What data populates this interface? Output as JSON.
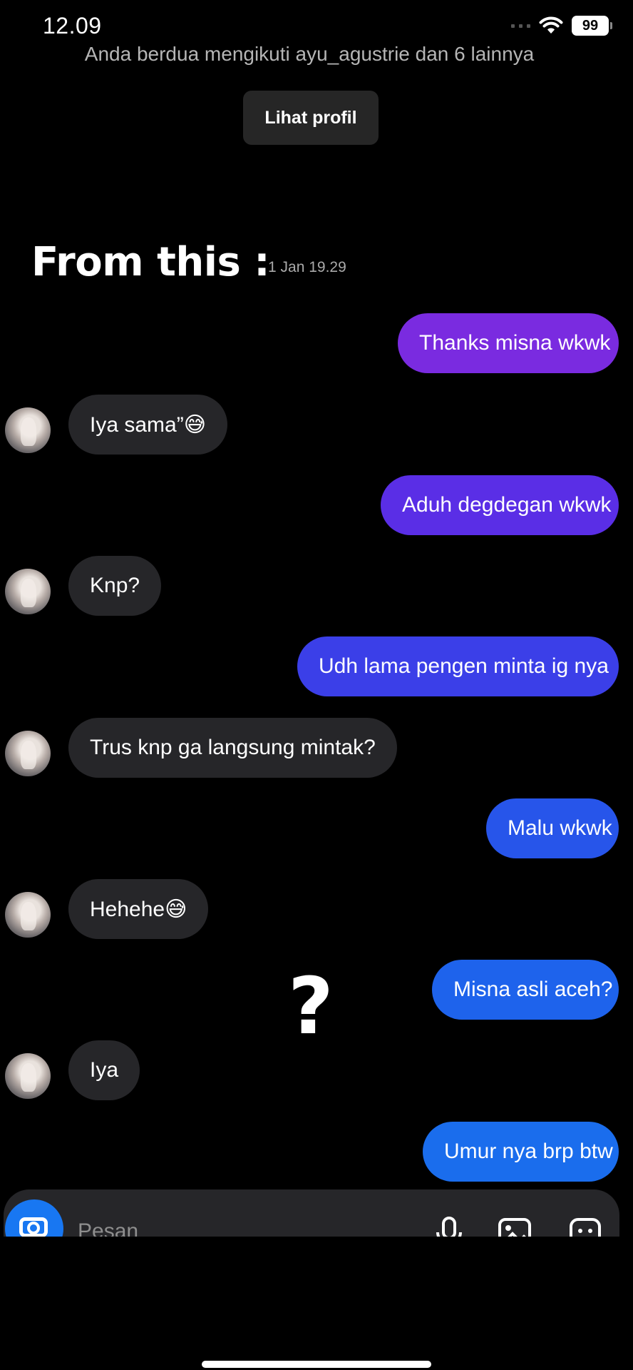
{
  "status_bar": {
    "time": "12.09",
    "battery": "99"
  },
  "header": {
    "follow_text": "Anda berdua mengikuti ayu_agustrie dan 6 lainnya",
    "profile_button": "Lihat profil"
  },
  "overlay": {
    "title": "From this :",
    "question": "?"
  },
  "conversation": {
    "date": "1 Jan 19.29",
    "messages": [
      {
        "side": "out",
        "text": "Thanks misna wkwk",
        "color": "#7a2be0"
      },
      {
        "side": "in",
        "text": "Iya sama”😅"
      },
      {
        "side": "out",
        "text": "Aduh degdegan wkwk",
        "color": "#5a2ee6"
      },
      {
        "side": "in",
        "text": "Knp?"
      },
      {
        "side": "out",
        "text": "Udh lama pengen minta ig nya",
        "color": "#3b3fe8"
      },
      {
        "side": "in",
        "text": "Trus knp ga langsung mintak?"
      },
      {
        "side": "out",
        "text": "Malu wkwk",
        "color": "#2755ea"
      },
      {
        "side": "in",
        "text": "Hehehe😅"
      },
      {
        "side": "out",
        "text": "Misna asli aceh?",
        "color": "#1e63ec"
      },
      {
        "side": "in",
        "text": "Iya"
      },
      {
        "side": "out",
        "text": "Umur nya brp btw",
        "color": "#1a6ded"
      }
    ]
  },
  "composer": {
    "placeholder": "Pesan"
  }
}
